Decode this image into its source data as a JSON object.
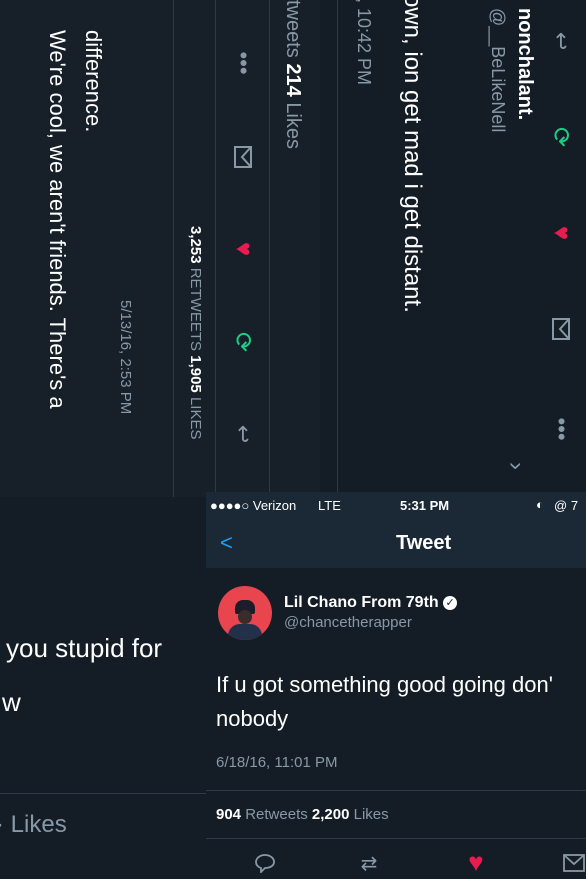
{
  "p1": {
    "tweet_text_line1": "We're cool, we aren't friends. There's a",
    "tweet_text_line2": "difference.",
    "timestamp": "5/13/16, 2:53 PM",
    "retweets_count": "3,253",
    "retweets_label": "RETWEETS",
    "likes_count": "1,905",
    "likes_label": "LIKES",
    "stats_count": "214",
    "stats_label": "Likes",
    "stats_prefix": "tweets"
  },
  "p2": {
    "display_name": "nonchalant.",
    "handle": "@__BeLikeNell",
    "tweet_text": "own, ion get mad i get distant.",
    "timestamp": ", 10:42 PM"
  },
  "p3": {
    "tweet_text_line1": "you stupid for",
    "tweet_text_line2": "w",
    "likes_label": "Likes"
  },
  "p4": {
    "status_bar": {
      "carrier": "●●●●○ Verizon",
      "network": "LTE",
      "time": "5:31 PM",
      "battery": "7"
    },
    "nav": {
      "back": "<",
      "title": "Tweet"
    },
    "display_name": "Lil Chano From 79th",
    "handle": "@chancetherapper",
    "tweet_text_line1": "If u got something good going don'",
    "tweet_text_line2": "nobody",
    "timestamp": "6/18/16, 11:01 PM",
    "retweets_count": "904",
    "retweets_label": "Retweets",
    "likes_count": "2,200",
    "likes_label": "Likes"
  },
  "colors": {
    "background": "#141d26",
    "text_gray": "#8899a6",
    "link_blue": "#1da1f2",
    "retweet_green": "#19cf86",
    "like_red": "#e81c4f"
  }
}
